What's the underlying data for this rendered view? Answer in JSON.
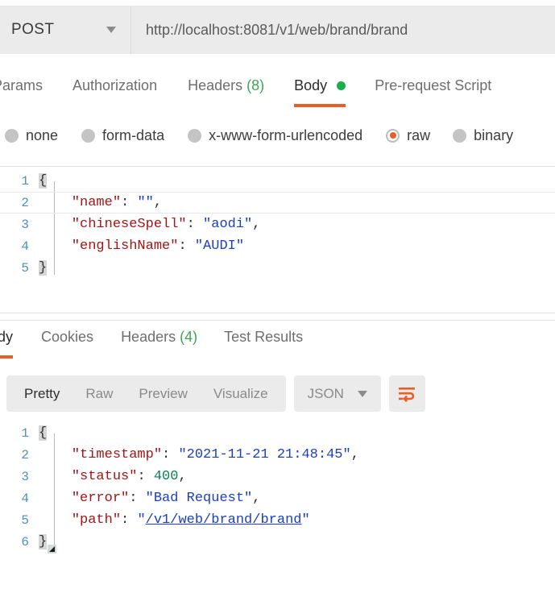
{
  "request_bar": {
    "method": "POST",
    "method_caret_icon": "chevron-down-icon",
    "url": "http://localhost:8081/v1/web/brand/brand"
  },
  "request_tabs": [
    {
      "label": "Params",
      "count": "",
      "active": false
    },
    {
      "label": "Authorization",
      "count": "",
      "active": false
    },
    {
      "label": "Headers",
      "count": "(8)",
      "active": false
    },
    {
      "label": "Body",
      "count": "",
      "active": true,
      "indicator": "green-dot"
    },
    {
      "label": "Pre-request Script",
      "count": "",
      "active": false
    }
  ],
  "body_types": [
    {
      "label": "none",
      "selected": false
    },
    {
      "label": "form-data",
      "selected": false
    },
    {
      "label": "x-www-form-urlencoded",
      "selected": false
    },
    {
      "label": "raw",
      "selected": true
    },
    {
      "label": "binary",
      "selected": false
    }
  ],
  "request_body": {
    "lines": [
      {
        "num": "1",
        "text": "{"
      },
      {
        "num": "2",
        "text": "    \"name\": \"\","
      },
      {
        "num": "3",
        "text": "    \"chineseSpell\": \"aodi\","
      },
      {
        "num": "4",
        "text": "    \"englishName\": \"AUDI\""
      },
      {
        "num": "5",
        "text": "}"
      }
    ],
    "active_line": "2"
  },
  "response_tabs": [
    {
      "label": "Body",
      "clipped_label": "ody",
      "count": "",
      "active": true
    },
    {
      "label": "Cookies",
      "count": "",
      "active": false
    },
    {
      "label": "Headers",
      "count": "(4)",
      "active": false
    },
    {
      "label": "Test Results",
      "count": "",
      "active": false
    }
  ],
  "view_modes": [
    {
      "label": "Pretty",
      "active": true
    },
    {
      "label": "Raw",
      "active": false
    },
    {
      "label": "Preview",
      "active": false
    },
    {
      "label": "Visualize",
      "active": false
    }
  ],
  "format_selector": {
    "label": "JSON",
    "caret_icon": "chevron-down-icon"
  },
  "wrap_button": {
    "icon": "word-wrap-icon"
  },
  "response_body": {
    "lines": [
      {
        "num": "1",
        "text": "{"
      },
      {
        "num": "2",
        "text": "    \"timestamp\": \"2021-11-21 21:48:45\","
      },
      {
        "num": "3",
        "text": "    \"status\": 400,"
      },
      {
        "num": "4",
        "text": "    \"error\": \"Bad Request\","
      },
      {
        "num": "5",
        "text": "    \"path\": \"/v1/web/brand/brand\""
      },
      {
        "num": "6",
        "text": "}"
      }
    ],
    "link_value": "/v1/web/brand/brand"
  },
  "colors": {
    "accent_orange": "#ef5b25",
    "indicator_green": "#1bae4c",
    "count_green": "#3aa757",
    "field_gray": "#ebebeb",
    "json_key": "#a31515",
    "json_string": "#1a3fc4",
    "json_number": "#0e8150",
    "gutter_blue": "#4f8fc0"
  }
}
